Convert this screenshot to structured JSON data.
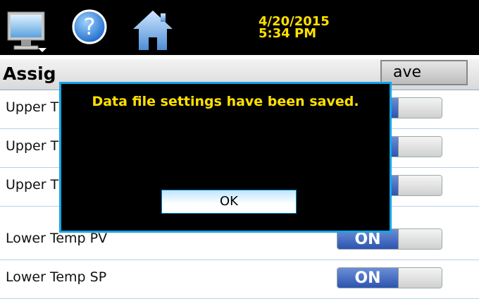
{
  "topbar": {
    "date": "4/20/2015",
    "time": "5:34 PM"
  },
  "header": {
    "title": "Assig",
    "save_label": "ave"
  },
  "rows": [
    {
      "label": "Upper T",
      "toggle": ""
    },
    {
      "label": "Upper T",
      "toggle": ""
    },
    {
      "label": "Upper T",
      "toggle": ""
    },
    {
      "label": "Lower Temp PV",
      "toggle": "ON"
    },
    {
      "label": "Lower Temp SP",
      "toggle": "ON"
    }
  ],
  "dialog": {
    "message": "Data file settings have been saved.",
    "ok_label": "OK"
  },
  "colors": {
    "topbar_bg": "#000000",
    "datetime": "#ffe100",
    "dialog_border": "#13a5e8",
    "dialog_text": "#ffe100",
    "toggle_on": "#2d55b0"
  },
  "icons": [
    "monitor-icon",
    "help-icon",
    "home-icon"
  ]
}
